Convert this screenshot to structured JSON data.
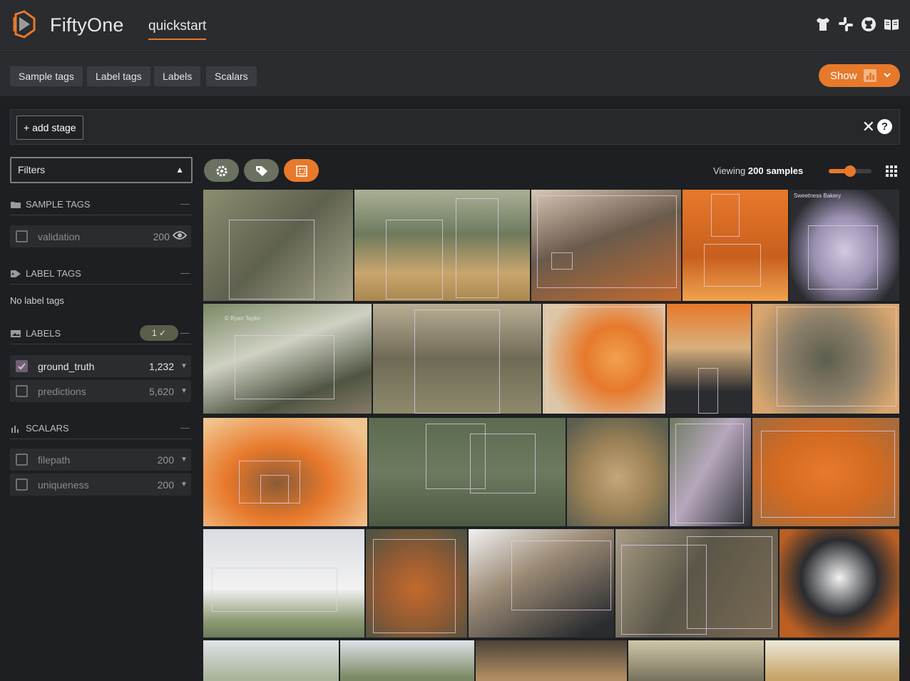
{
  "app": {
    "brand": "FiftyOne",
    "dataset": "quickstart"
  },
  "header_icons": [
    "tshirt-icon",
    "slack-icon",
    "github-icon",
    "docs-book-icon"
  ],
  "tabs": [
    "Sample tags",
    "Label tags",
    "Labels",
    "Scalars"
  ],
  "show_button": {
    "label": "Show",
    "icon": "bar-chart-icon"
  },
  "stage": {
    "add_label": "+ add stage",
    "close_icon": "✕",
    "help_icon": "?"
  },
  "sidebar": {
    "filter_label": "Filters",
    "sample_tags": {
      "title": "SAMPLE TAGS",
      "items": [
        {
          "label": "validation",
          "count": "200"
        }
      ]
    },
    "label_tags": {
      "title": "LABEL TAGS",
      "empty": "No label tags"
    },
    "labels": {
      "title": "LABELS",
      "badge": "1 ✓",
      "items": [
        {
          "label": "ground_truth",
          "count": "1,232",
          "checked": true
        },
        {
          "label": "predictions",
          "count": "5,620",
          "checked": false
        }
      ]
    },
    "scalars": {
      "title": "SCALARS",
      "items": [
        {
          "label": "filepath",
          "count": "200"
        },
        {
          "label": "uniqueness",
          "count": "200"
        }
      ]
    }
  },
  "grid_controls": {
    "viewing_prefix": "Viewing",
    "viewing_count": "200 samples",
    "zoom_level": 0.5
  },
  "image_text": {
    "train_watermark": "© Ryan Taylor",
    "cake_text": "Sweetness Bakery"
  },
  "colors": {
    "accent": "#e7792b",
    "panel": "#2a2c30",
    "background": "#1d1f22",
    "tag_green": "#6b7161"
  }
}
